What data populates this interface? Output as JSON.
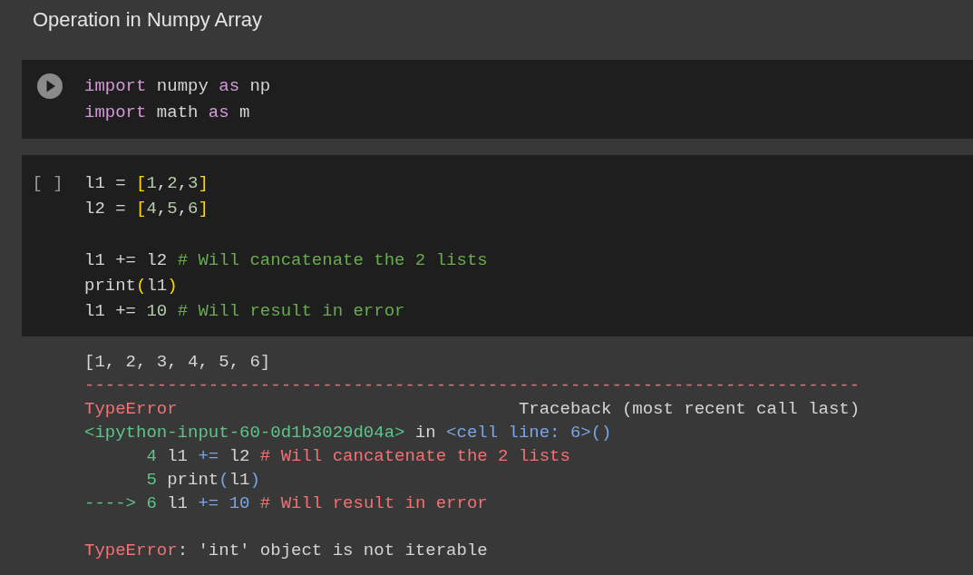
{
  "title": "Operation in Numpy Array",
  "cells": [
    {
      "gutter": {
        "kind": "run"
      },
      "lines": [
        {
          "kind": "code",
          "tokens": [
            {
              "kind": "keyword",
              "text": "import"
            },
            {
              "kind": "plain",
              "text": " numpy "
            },
            {
              "kind": "keyword",
              "text": "as"
            },
            {
              "kind": "plain",
              "text": " np"
            }
          ]
        },
        {
          "kind": "code",
          "tokens": [
            {
              "kind": "keyword",
              "text": "import"
            },
            {
              "kind": "plain",
              "text": " math "
            },
            {
              "kind": "keyword",
              "text": "as"
            },
            {
              "kind": "plain",
              "text": " m"
            }
          ]
        }
      ]
    },
    {
      "gutter": {
        "kind": "label",
        "text": "[ ]"
      },
      "lines": [
        {
          "kind": "code",
          "tokens": [
            {
              "kind": "plain",
              "text": "l1 = "
            },
            {
              "kind": "bracket",
              "text": "["
            },
            {
              "kind": "number",
              "text": "1"
            },
            {
              "kind": "plain",
              "text": ","
            },
            {
              "kind": "number",
              "text": "2"
            },
            {
              "kind": "plain",
              "text": ","
            },
            {
              "kind": "number",
              "text": "3"
            },
            {
              "kind": "bracket",
              "text": "]"
            }
          ]
        },
        {
          "kind": "code",
          "tokens": [
            {
              "kind": "plain",
              "text": "l2 = "
            },
            {
              "kind": "bracket",
              "text": "["
            },
            {
              "kind": "number",
              "text": "4"
            },
            {
              "kind": "plain",
              "text": ","
            },
            {
              "kind": "number",
              "text": "5"
            },
            {
              "kind": "plain",
              "text": ","
            },
            {
              "kind": "number",
              "text": "6"
            },
            {
              "kind": "bracket",
              "text": "]"
            }
          ]
        },
        {
          "kind": "blank"
        },
        {
          "kind": "code",
          "tokens": [
            {
              "kind": "plain",
              "text": "l1 += l2 "
            },
            {
              "kind": "comment",
              "text": "# Will cancatenate the 2 lists"
            }
          ]
        },
        {
          "kind": "code",
          "tokens": [
            {
              "kind": "plain",
              "text": "print"
            },
            {
              "kind": "bracket",
              "text": "("
            },
            {
              "kind": "plain",
              "text": "l1"
            },
            {
              "kind": "bracket",
              "text": ")"
            }
          ]
        },
        {
          "kind": "code",
          "tokens": [
            {
              "kind": "plain",
              "text": "l1 += "
            },
            {
              "kind": "number",
              "text": "10"
            },
            {
              "kind": "comment",
              "text": " # Will result in error"
            }
          ]
        }
      ],
      "output": [
        {
          "kind": "text",
          "tokens": [
            {
              "kind": "plain",
              "text": "[1, 2, 3, 4, 5, 6]"
            }
          ]
        },
        {
          "kind": "text",
          "tokens": [
            {
              "kind": "error",
              "text": "---------------------------------------------------------------------------"
            }
          ]
        },
        {
          "kind": "split",
          "left": [
            {
              "kind": "error",
              "text": "TypeError"
            }
          ],
          "right": [
            {
              "kind": "plain",
              "text": "Traceback (most recent call last)"
            }
          ]
        },
        {
          "kind": "text",
          "tokens": [
            {
              "kind": "green",
              "text": "<ipython-input-60-0d1b3029d04a>"
            },
            {
              "kind": "plain",
              "text": " in "
            },
            {
              "kind": "blue",
              "text": "<cell line: 6>()"
            }
          ]
        },
        {
          "kind": "text",
          "tokens": [
            {
              "kind": "green",
              "text": "      4 "
            },
            {
              "kind": "plain",
              "text": "l1 "
            },
            {
              "kind": "blue",
              "text": "+="
            },
            {
              "kind": "plain",
              "text": " l2 "
            },
            {
              "kind": "error",
              "text": "# Will cancatenate the 2 lists"
            }
          ]
        },
        {
          "kind": "text",
          "tokens": [
            {
              "kind": "green",
              "text": "      5 "
            },
            {
              "kind": "plain",
              "text": "print"
            },
            {
              "kind": "blue",
              "text": "("
            },
            {
              "kind": "plain",
              "text": "l1"
            },
            {
              "kind": "blue",
              "text": ")"
            }
          ]
        },
        {
          "kind": "text",
          "tokens": [
            {
              "kind": "green",
              "text": "----> 6 "
            },
            {
              "kind": "plain",
              "text": "l1 "
            },
            {
              "kind": "blue",
              "text": "+="
            },
            {
              "kind": "blue",
              "text": " 10"
            },
            {
              "kind": "error",
              "text": " # Will result in error"
            }
          ]
        },
        {
          "kind": "blank"
        },
        {
          "kind": "text",
          "tokens": [
            {
              "kind": "error",
              "text": "TypeError"
            },
            {
              "kind": "plain",
              "text": ": 'int' object is not iterable"
            }
          ]
        }
      ]
    }
  ]
}
